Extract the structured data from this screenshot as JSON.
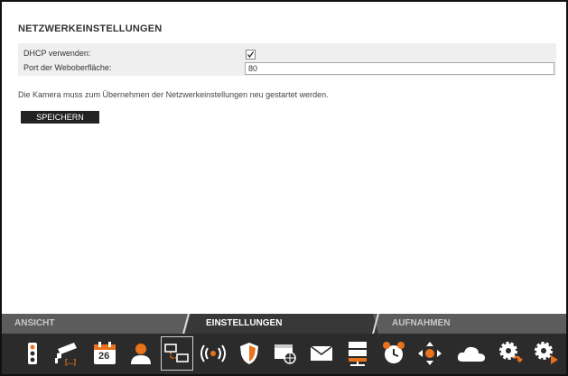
{
  "page": {
    "title": "NETZWERKEINSTELLUNGEN",
    "dhcp_label": "DHCP verwenden:",
    "dhcp_checked": true,
    "port_label": "Port der Weboberfläche:",
    "port_value": "80",
    "note": "Die Kamera muss zum Übernehmen der Netzwerkeinstellungen neu gestartet werden.",
    "save_label": "SPEICHERN"
  },
  "tabs": [
    {
      "label": "ANSICHT",
      "active": false
    },
    {
      "label": "EINSTELLUNGEN",
      "active": true
    },
    {
      "label": "AUFNAHMEN",
      "active": false
    }
  ],
  "toolbar": {
    "calendar_day": "26",
    "ellipsis": "[...]",
    "icons": [
      "traffic-light-icon",
      "camera-icon",
      "calendar-icon",
      "user-icon",
      "network-icon",
      "wireless-icon",
      "shield-icon",
      "web-window-icon",
      "mail-icon",
      "server-icon",
      "alarm-clock-icon",
      "ptz-move-icon",
      "cloud-icon",
      "gear-refresh-icon",
      "gear-play-icon"
    ],
    "active_icon": "network-icon"
  },
  "colors": {
    "accent": "#e8731c",
    "toolbar_bg": "#2b2b2b",
    "tab_bg": "#5c5c5c"
  }
}
